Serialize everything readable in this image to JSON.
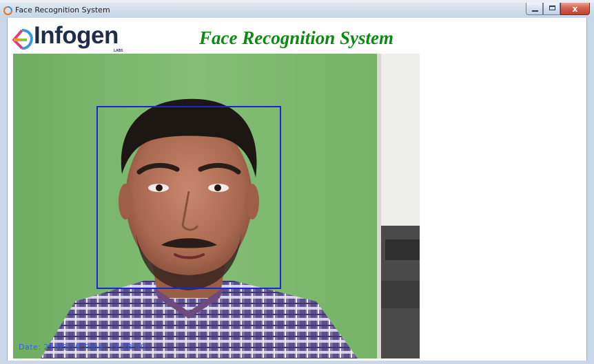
{
  "window": {
    "title": "Face Recognition System",
    "close_label": "x"
  },
  "header": {
    "logo_text": "Infogen",
    "logo_sub": "LABS",
    "app_title": "Face Recognition System"
  },
  "video": {
    "overlay": "Date: 21/05/19 Time: 12:28:40",
    "face_detected": true,
    "box_color": "#1a24d6",
    "overlay_color": "#2d62e6"
  },
  "colors": {
    "title_green": "#0b8a12",
    "background_wall": "#7ab56e"
  }
}
